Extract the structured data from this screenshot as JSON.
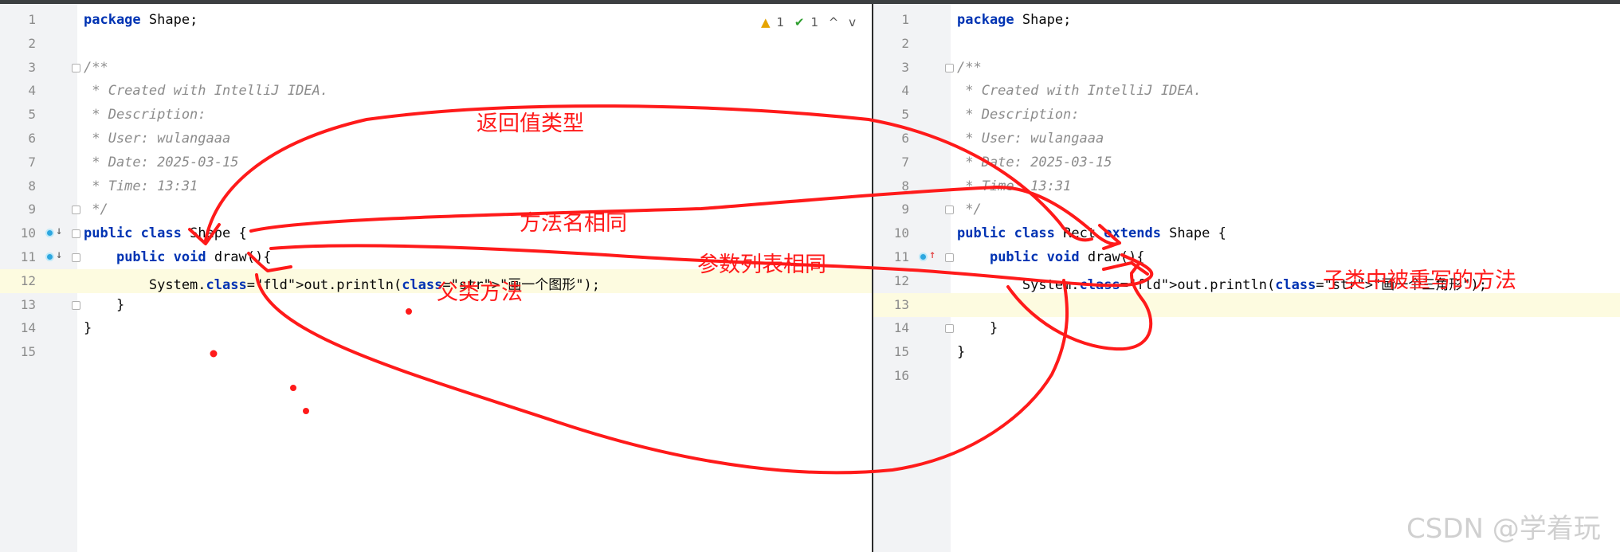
{
  "left_editor": {
    "toolbar": {
      "warnings": "1",
      "checks": "1",
      "up_label": "^",
      "down_label": "v"
    },
    "lines": [
      {
        "n": "1",
        "code": "package Shape;"
      },
      {
        "n": "2",
        "code": ""
      },
      {
        "n": "3",
        "code": "/**"
      },
      {
        "n": "4",
        "code": " * Created with IntelliJ IDEA."
      },
      {
        "n": "5",
        "code": " * Description:"
      },
      {
        "n": "6",
        "code": " * User: wulangaaa"
      },
      {
        "n": "7",
        "code": " * Date: 2025-03-15"
      },
      {
        "n": "8",
        "code": " * Time: 13:31"
      },
      {
        "n": "9",
        "code": " */"
      },
      {
        "n": "10",
        "code": "public class Shape {"
      },
      {
        "n": "11",
        "code": "    public void draw(){"
      },
      {
        "n": "12",
        "code": "        System.out.println(\"画一个图形\");"
      },
      {
        "n": "13",
        "code": "    }"
      },
      {
        "n": "14",
        "code": "}"
      },
      {
        "n": "15",
        "code": ""
      }
    ]
  },
  "right_editor": {
    "lines": [
      {
        "n": "1",
        "code": "package Shape;"
      },
      {
        "n": "2",
        "code": ""
      },
      {
        "n": "3",
        "code": "/**"
      },
      {
        "n": "4",
        "code": " * Created with IntelliJ IDEA."
      },
      {
        "n": "5",
        "code": " * Description:"
      },
      {
        "n": "6",
        "code": " * User: wulangaaa"
      },
      {
        "n": "7",
        "code": " * Date: 2025-03-15"
      },
      {
        "n": "8",
        "code": " * Time: 13:31"
      },
      {
        "n": "9",
        "code": " */"
      },
      {
        "n": "10",
        "code": "public class Rect extends Shape {"
      },
      {
        "n": "11",
        "code": "    public void draw(){"
      },
      {
        "n": "12",
        "code": "        System.out.println(\"画一个三角形\");"
      },
      {
        "n": "13",
        "code": ""
      },
      {
        "n": "14",
        "code": "    }"
      },
      {
        "n": "15",
        "code": "}"
      },
      {
        "n": "16",
        "code": ""
      }
    ]
  },
  "annotations": {
    "return_type": "返回值类型",
    "same_method_name": "方法名相同",
    "same_param_list": "参数列表相同",
    "parent_method": "父类方法",
    "overridden_method": "子类中被重写的方法"
  },
  "watermark": "CSDN @学着玩",
  "colors": {
    "annotation": "#ff1a1a",
    "keyword": "#0033b3",
    "string": "#067d17",
    "highlight_line": "#fdfbe0"
  }
}
